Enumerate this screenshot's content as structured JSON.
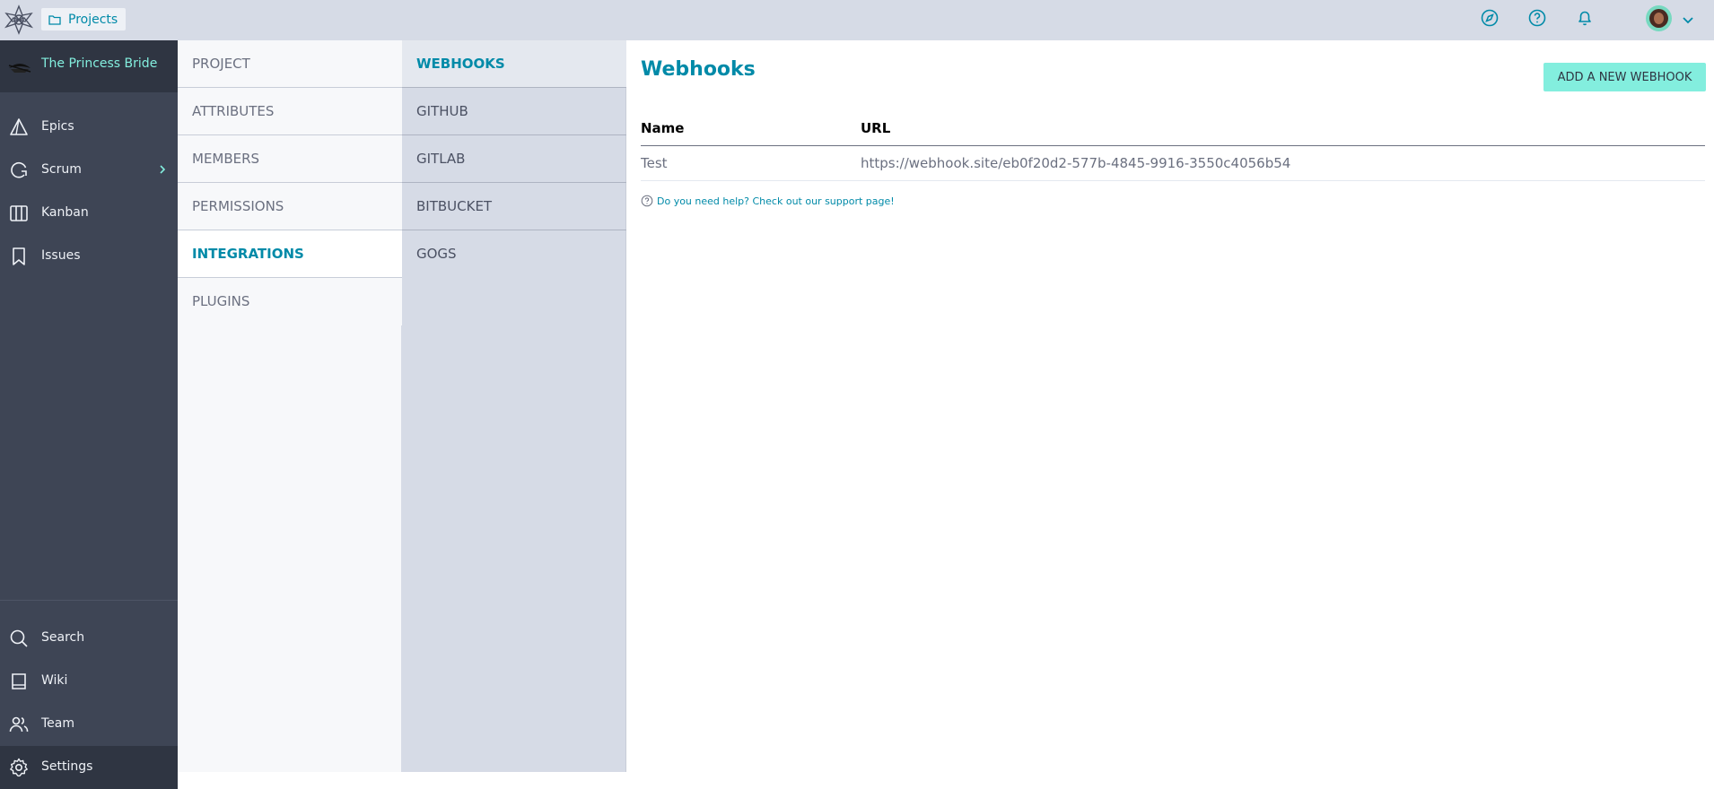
{
  "topbar": {
    "projects_label": "Projects",
    "icons": [
      "logo-icon",
      "folder-icon",
      "compass-icon",
      "help-icon",
      "bell-icon",
      "avatar",
      "chevron-down-icon"
    ]
  },
  "sidebar": {
    "project_name": "The Princess Bride",
    "items": [
      {
        "label": "Epics",
        "icon": "epics-icon"
      },
      {
        "label": "Scrum",
        "icon": "scrum-icon"
      },
      {
        "label": "Kanban",
        "icon": "kanban-icon"
      },
      {
        "label": "Issues",
        "icon": "issues-icon"
      }
    ],
    "bottom_items": [
      {
        "label": "Search",
        "icon": "search-icon"
      },
      {
        "label": "Wiki",
        "icon": "wiki-icon"
      },
      {
        "label": "Team",
        "icon": "team-icon"
      },
      {
        "label": "Settings",
        "icon": "gear-icon"
      }
    ]
  },
  "settings_menu": {
    "items": [
      "PROJECT",
      "ATTRIBUTES",
      "MEMBERS",
      "PERMISSIONS",
      "INTEGRATIONS",
      "PLUGINS"
    ],
    "active": "INTEGRATIONS"
  },
  "integrations_menu": {
    "items": [
      "WEBHOOKS",
      "GITHUB",
      "GITLAB",
      "BITBUCKET",
      "GOGS"
    ],
    "active": "WEBHOOKS"
  },
  "main": {
    "title": "Webhooks",
    "add_button": "ADD A NEW WEBHOOK",
    "table": {
      "headers": [
        "Name",
        "URL"
      ],
      "rows": [
        {
          "name": "Test",
          "url": "https://webhook.site/eb0f20d2-577b-4845-9916-3550c4056b54"
        }
      ]
    },
    "help_text": "Do you need help? Check out our support page!"
  },
  "colors": {
    "accent": "#008aa8",
    "mint": "#83eede",
    "sidebar_bg": "#3e4555",
    "topbar_bg": "#d6dbe6"
  }
}
